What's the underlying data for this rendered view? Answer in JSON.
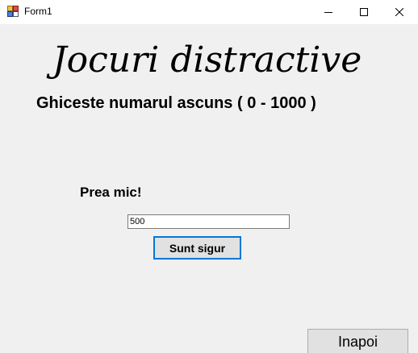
{
  "window": {
    "title": "Form1"
  },
  "main": {
    "heading": "Jocuri distractive",
    "subtitle": "Ghiceste numarul ascuns ( 0 - 1000 )",
    "hint": "Prea mic!",
    "guess_value": "500",
    "submit_label": "Sunt sigur",
    "back_label": "Inapoi"
  },
  "icons": {
    "app": "winforms-app-icon",
    "minimize": "minimize-icon",
    "maximize": "maximize-icon",
    "close": "close-icon"
  },
  "colors": {
    "background": "#f0f0f0",
    "titlebar": "#ffffff",
    "button_face": "#e1e1e1",
    "focus_border": "#0078d7"
  }
}
